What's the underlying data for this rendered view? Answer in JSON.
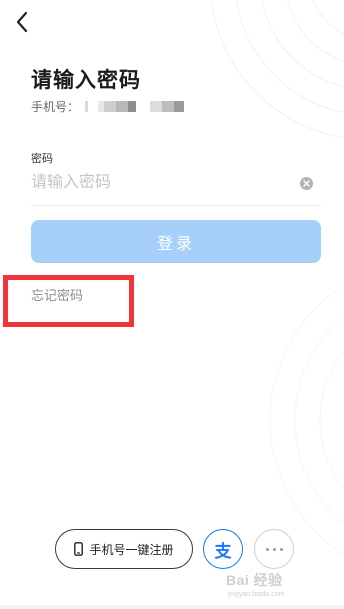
{
  "header": {
    "back_icon": "chevron-left-icon"
  },
  "title": "请输入密码",
  "phone": {
    "label": "手机号："
  },
  "password_field": {
    "label": "密码",
    "placeholder": "请输入密码",
    "value": "",
    "clear_icon": "clear-circle-icon"
  },
  "login_button": {
    "label": "登录",
    "color": "#a6d0fa"
  },
  "forgot_link": {
    "label": "忘记密码"
  },
  "bottom": {
    "onekey_label": "手机号一键注册",
    "phone_icon": "mobile-phone-icon",
    "alipay_icon": "alipay-icon",
    "alipay_glyph": "支",
    "more_icon": "more-dots-icon"
  },
  "watermark": {
    "main": "Bai 经验",
    "sub": "jingyan.baidu.com"
  },
  "colors": {
    "accent": "#1677ff",
    "highlight": "#f0343a"
  }
}
